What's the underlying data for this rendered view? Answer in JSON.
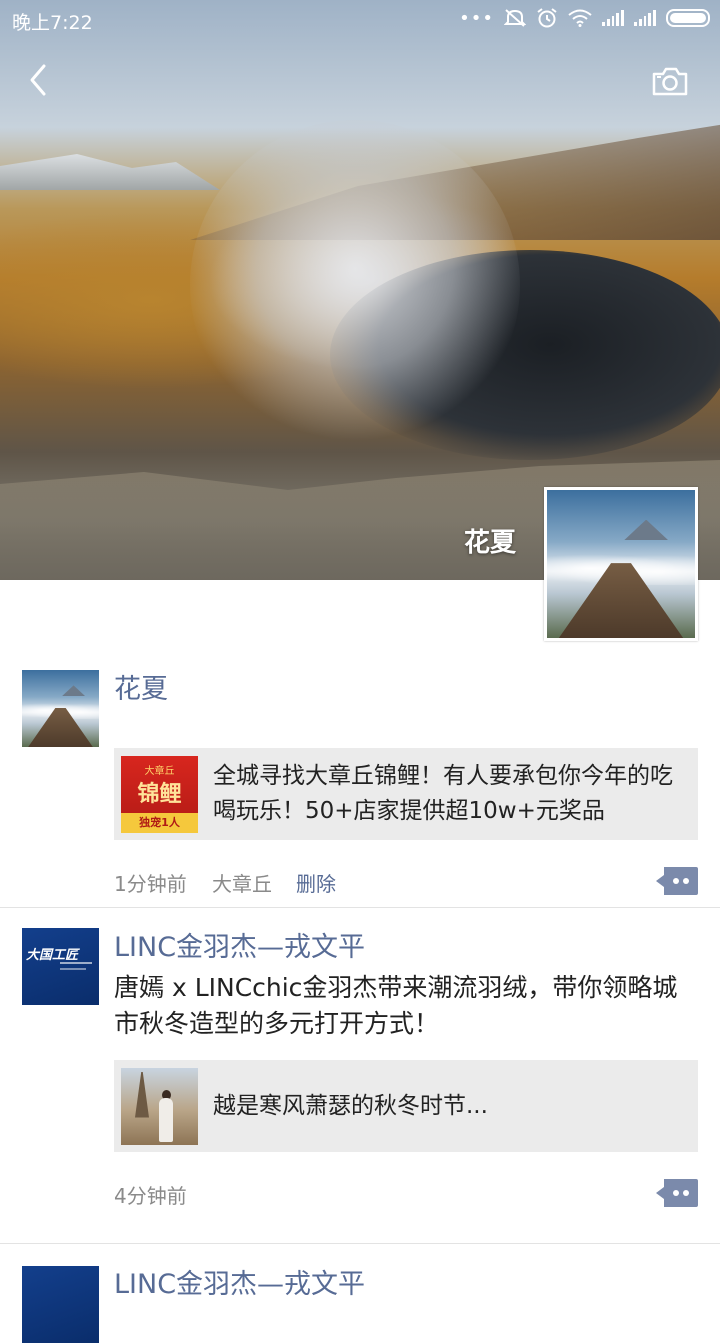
{
  "status_bar": {
    "time": "晚上7:22"
  },
  "header": {
    "back_icon": "chevron-left-icon",
    "camera_icon": "camera-icon"
  },
  "profile": {
    "name": "花夏"
  },
  "posts": [
    {
      "author": "花夏",
      "text": "",
      "link": {
        "title": "全城寻找大章丘锦鲤！有人要承包你今年的吃喝玩乐！50+店家提供超10w+元奖品",
        "thumb_text_top": "大章丘",
        "thumb_text_main": "锦鲤",
        "thumb_text_bottom": "独宠1人"
      },
      "time": "1分钟前",
      "location": "大章丘",
      "delete_label": "删除"
    },
    {
      "author": "LINC金羽杰—戎文平",
      "text": "唐嫣 x LINCchic金羽杰带来潮流羽绒，带你领略城市秋冬造型的多元打开方式！",
      "link": {
        "title": "越是寒风萧瑟的秋冬时节..."
      },
      "avatar_text": "大国工匠",
      "time": "4分钟前"
    },
    {
      "author": "LINC金羽杰—戎文平"
    }
  ],
  "colors": {
    "link_blue": "#576b95",
    "card_bg": "#ebebeb"
  }
}
